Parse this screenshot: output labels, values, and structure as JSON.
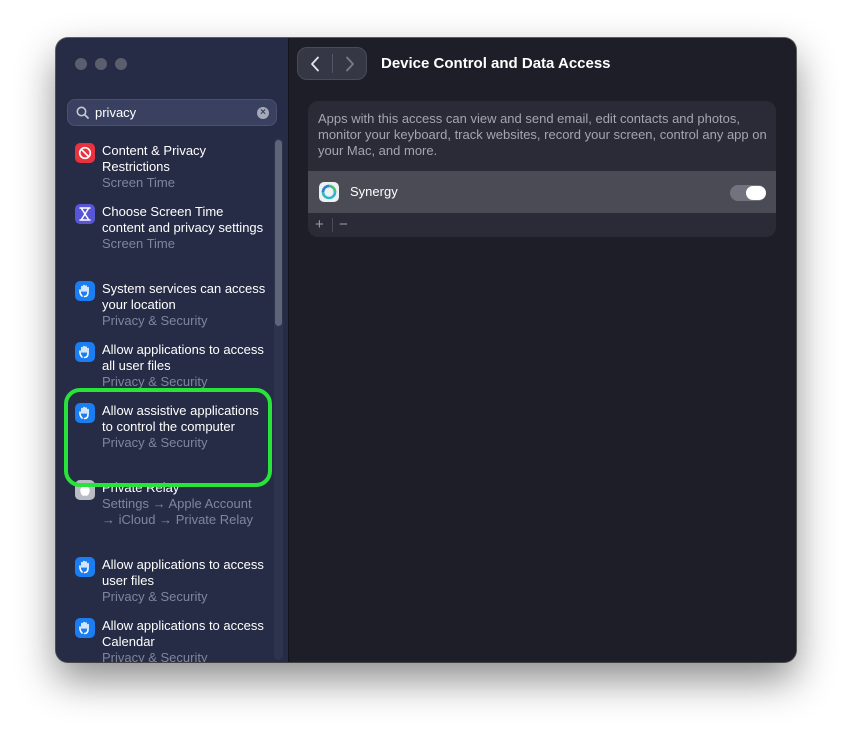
{
  "window": {
    "title": "Device Control and Data Access"
  },
  "search": {
    "value": "privacy",
    "clear_glyph": "×"
  },
  "results": [
    {
      "icon": "no-entry-icon",
      "title": "Content & Privacy Restrictions",
      "subtitle": "Screen Time"
    },
    {
      "icon": "hourglass-icon",
      "title": "Choose Screen Time content and privacy settings",
      "subtitle": "Screen Time"
    },
    {
      "icon": "hand-icon",
      "title": "System services can access your location",
      "subtitle": "Privacy & Security"
    },
    {
      "icon": "hand-icon",
      "title": "Allow applications to access all user files",
      "subtitle": "Privacy & Security"
    },
    {
      "icon": "hand-icon",
      "title": "Allow assistive applications to control the computer",
      "subtitle": "Privacy & Security"
    },
    {
      "icon": "apple-icon",
      "title": "Private Relay",
      "subtitle": "Settings → Apple Account → iCloud → Private Relay"
    },
    {
      "icon": "hand-icon",
      "title": "Allow applications to access user files",
      "subtitle": "Privacy & Security"
    },
    {
      "icon": "hand-icon",
      "title": "Allow applications to access Calendar",
      "subtitle": "Privacy & Security"
    }
  ],
  "main": {
    "description": "Apps with this access can view and send email, edit contacts and photos, monitor your keyboard, track websites, record your screen, control any app on your Mac, and more.",
    "apps": [
      {
        "name": "Synergy",
        "enabled": true
      }
    ],
    "add_label": "+",
    "remove_label": "−"
  },
  "colors": {
    "accent": "#1a7df1",
    "highlight": "#27e33a",
    "sidebar": "#262c45",
    "content": "#1e1e28"
  }
}
